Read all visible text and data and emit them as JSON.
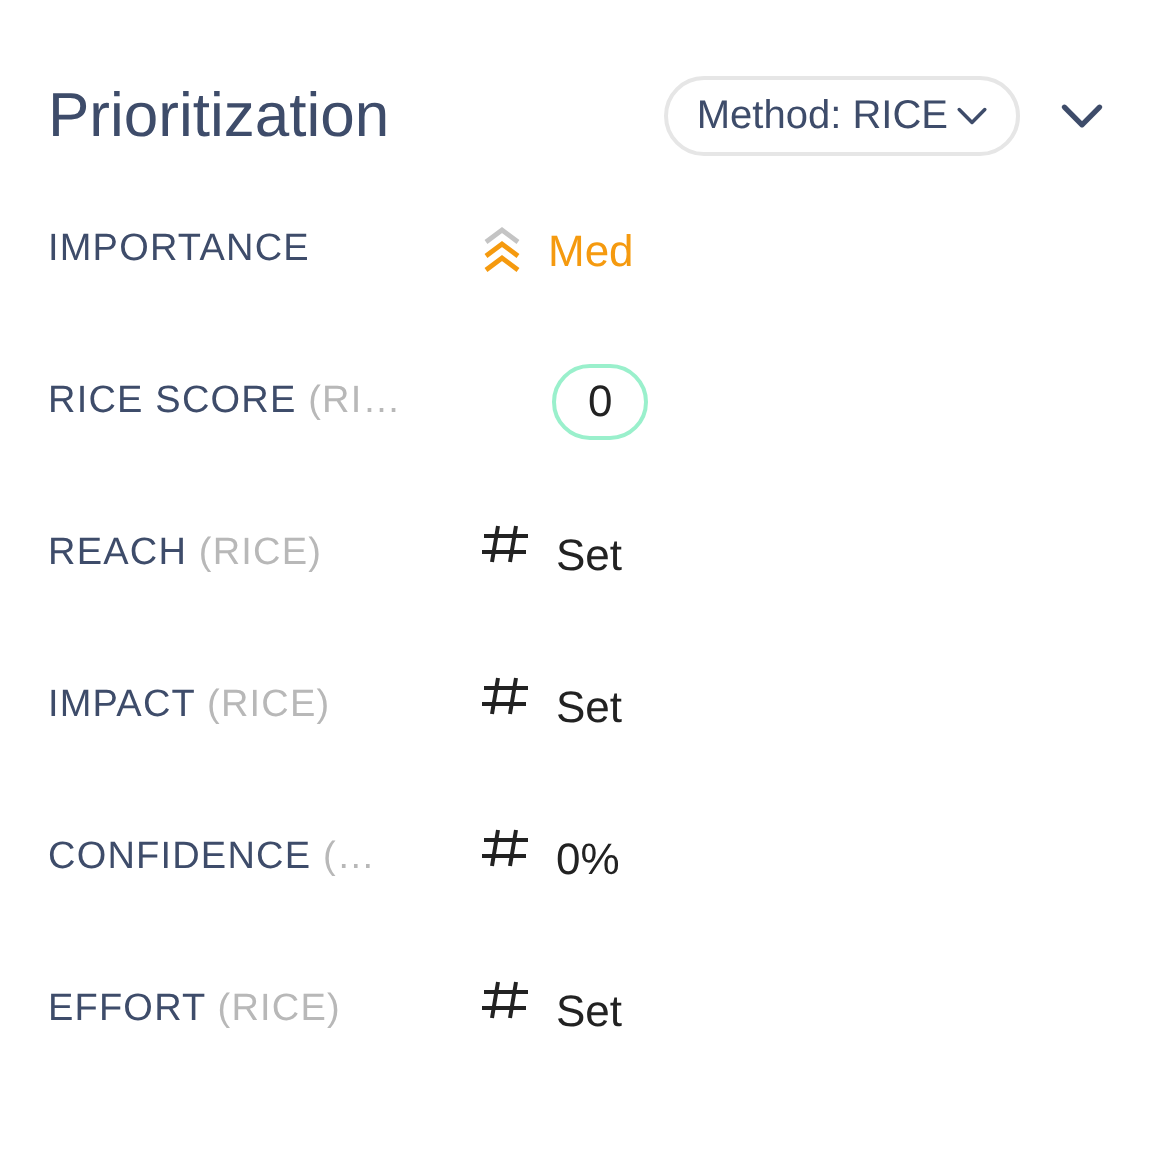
{
  "header": {
    "title": "Prioritization",
    "method_button": "Method: RICE"
  },
  "fields": [
    {
      "label": "IMPORTANCE",
      "kind": "priority",
      "value": "Med",
      "color": "#f59a0f"
    },
    {
      "label": "RICE SCORE",
      "suffix": "(RI…",
      "kind": "score",
      "value": "0"
    },
    {
      "label": "REACH",
      "suffix": "(RICE)",
      "kind": "number",
      "value": "Set"
    },
    {
      "label": "IMPACT",
      "suffix": "(RICE)",
      "kind": "number",
      "value": "Set"
    },
    {
      "label": "CONFIDENCE",
      "suffix": "(…",
      "kind": "number",
      "value": "0%"
    },
    {
      "label": "EFFORT",
      "suffix": "(RICE)",
      "kind": "number",
      "value": "Set"
    }
  ]
}
